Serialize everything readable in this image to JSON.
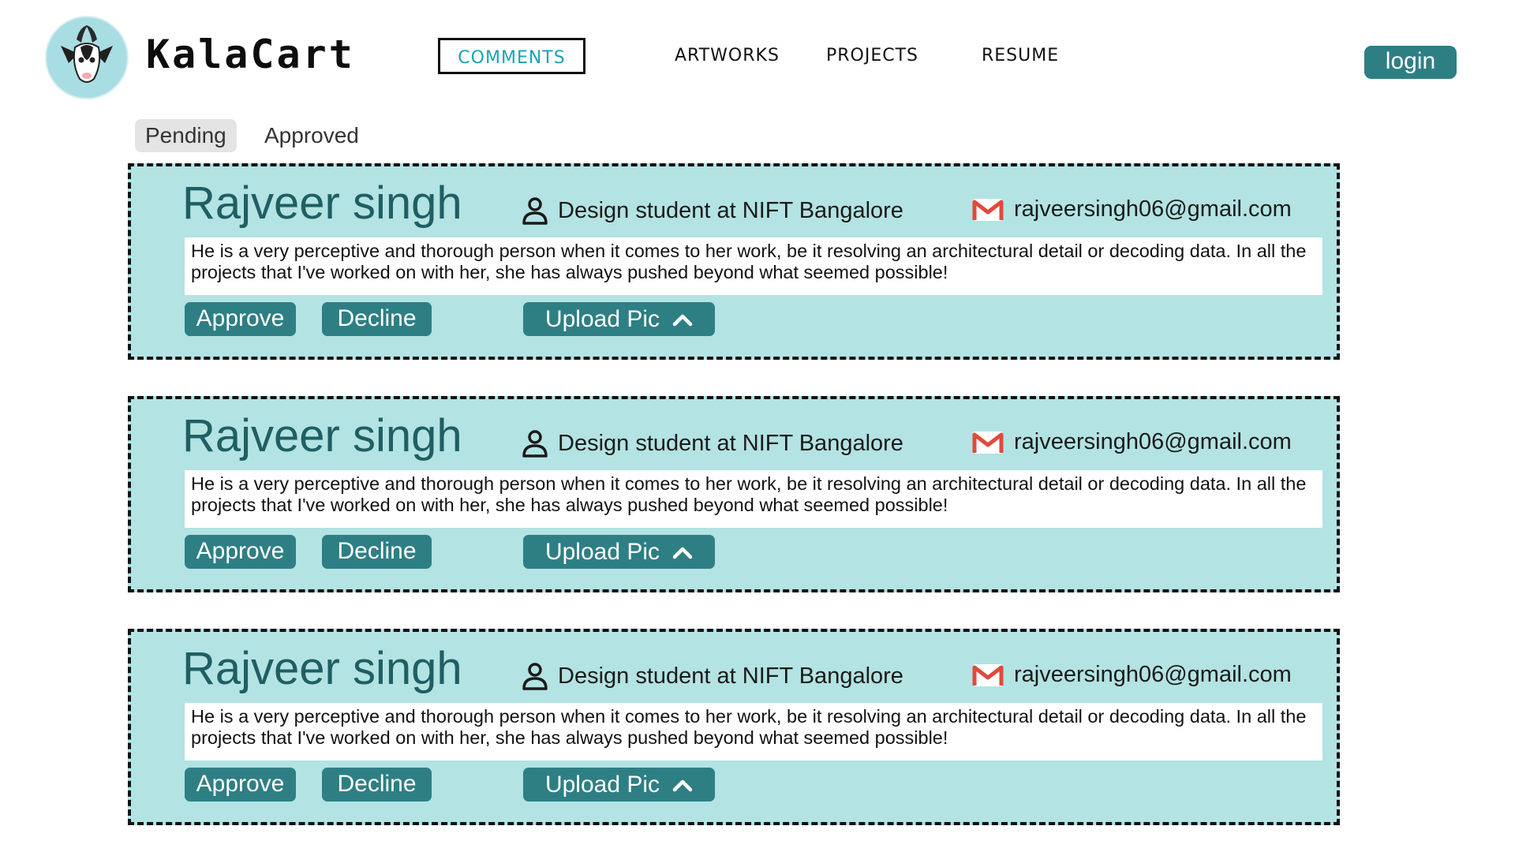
{
  "header": {
    "brand": "KalaCart",
    "nav": [
      {
        "label": "COMMENTS",
        "active": true
      },
      {
        "label": "ARTWORKS"
      },
      {
        "label": "PROJECTS"
      },
      {
        "label": "RESUME"
      }
    ],
    "login_label": "login"
  },
  "filters": {
    "tabs": [
      {
        "label": "Pending",
        "active": true
      },
      {
        "label": "Approved"
      }
    ]
  },
  "comments": [
    {
      "name": "Rajveer singh",
      "role": "Design student at NIFT Bangalore",
      "email": "rajveersingh06@gmail.com",
      "text": "He is a very perceptive and thorough person when it comes to her work, be it resolving an architectural detail or decoding data. In all the projects that I've worked on with her, she has always pushed beyond what seemed possible!",
      "approve_label": "Approve",
      "decline_label": "Decline",
      "upload_label": "Upload Pic"
    },
    {
      "name": "Rajveer singh",
      "role": "Design student at NIFT Bangalore",
      "email": "rajveersingh06@gmail.com",
      "text": "He is a very perceptive and thorough person when it comes to her work, be it resolving an architectural detail or decoding data. In all the projects that I've worked on with her, she has always pushed beyond what seemed possible!",
      "approve_label": "Approve",
      "decline_label": "Decline",
      "upload_label": "Upload Pic"
    },
    {
      "name": "Rajveer singh",
      "role": "Design student at NIFT Bangalore",
      "email": "rajveersingh06@gmail.com",
      "text": "He is a very perceptive and thorough person when it comes to her work, be it resolving an architectural detail or decoding data. In all the projects that I've worked on with her, she has always pushed beyond what seemed possible!",
      "approve_label": "Approve",
      "decline_label": "Decline",
      "upload_label": "Upload Pic"
    }
  ],
  "icons": {
    "logo": "goat-logo-icon",
    "role": "person-icon",
    "email": "gmail-icon",
    "upload": "chevron-up-icon"
  },
  "colors": {
    "accent": "#2e7f84",
    "card_bg": "#b3e3e3",
    "name_text": "#1f5f63",
    "active_nav_text": "#1aa3b3",
    "logo_bg": "#a8dde3",
    "gmail_red": "#e04a3c"
  }
}
